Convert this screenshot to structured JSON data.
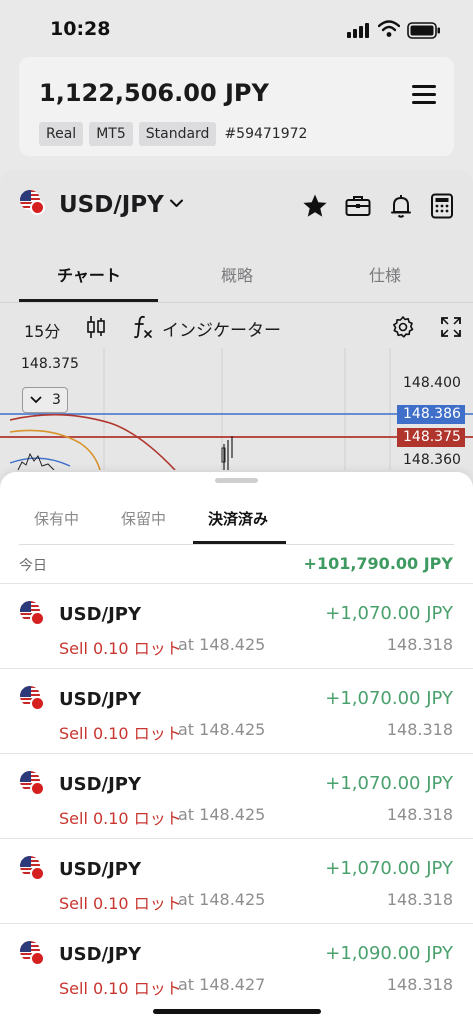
{
  "status_bar": {
    "time": "10:28"
  },
  "account": {
    "balance": "1,122,506.00 JPY",
    "badges": [
      "Real",
      "MT5",
      "Standard"
    ],
    "account_number": "#59471972"
  },
  "instrument": {
    "symbol": "USD/JPY",
    "tabs": [
      "チャート",
      "概略",
      "仕様"
    ],
    "timeframe": "15分",
    "indicator_label": "インジケーター"
  },
  "chart": {
    "top_price": "148.375",
    "collapse_count": "3",
    "axis_prices": [
      "148.400",
      "148.360"
    ],
    "price_tags": [
      {
        "value": "148.386",
        "color": "#3f6fc9"
      },
      {
        "value": "148.375",
        "color": "#b0352c"
      }
    ]
  },
  "sheet": {
    "tabs": [
      "保有中",
      "保留中",
      "決済済み"
    ],
    "summary": {
      "label": "今日",
      "total": "+101,790.00 JPY"
    },
    "trades": [
      {
        "symbol": "USD/JPY",
        "side": "Sell 0.10 ロット",
        "at": "at 148.425",
        "profit": "+1,070.00 JPY",
        "close": "148.318"
      },
      {
        "symbol": "USD/JPY",
        "side": "Sell 0.10 ロット",
        "at": "at 148.425",
        "profit": "+1,070.00 JPY",
        "close": "148.318"
      },
      {
        "symbol": "USD/JPY",
        "side": "Sell 0.10 ロット",
        "at": "at 148.425",
        "profit": "+1,070.00 JPY",
        "close": "148.318"
      },
      {
        "symbol": "USD/JPY",
        "side": "Sell 0.10 ロット",
        "at": "at 148.425",
        "profit": "+1,070.00 JPY",
        "close": "148.318"
      },
      {
        "symbol": "USD/JPY",
        "side": "Sell 0.10 ロット",
        "at": "at 148.427",
        "profit": "+1,090.00 JPY",
        "close": "148.318"
      }
    ]
  },
  "colors": {
    "profit": "#4aa16d",
    "sell": "#c8352f",
    "accent": "#1a1a1a"
  }
}
